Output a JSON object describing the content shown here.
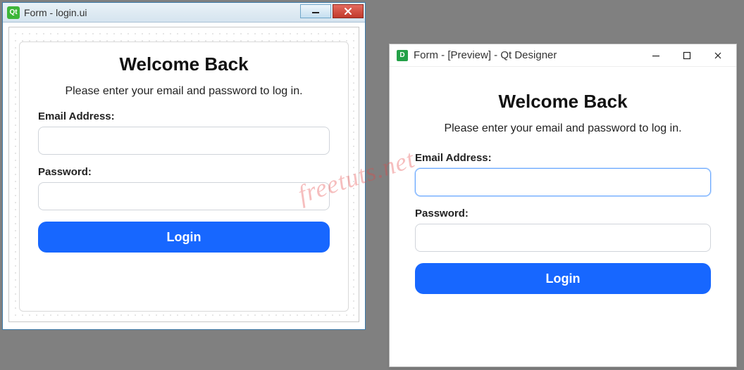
{
  "designer": {
    "window_title": "Form - login.ui",
    "icon_text": "Qt",
    "heading": "Welcome Back",
    "subtitle": "Please enter your email and password to log in.",
    "email_label": "Email Address:",
    "password_label": "Password:",
    "login_button": "Login"
  },
  "preview": {
    "window_title": "Form - [Preview] - Qt Designer",
    "icon_text": "D",
    "heading": "Welcome Back",
    "subtitle": "Please enter your email and password to log in.",
    "email_label": "Email Address:",
    "password_label": "Password:",
    "login_button": "Login"
  },
  "watermark": "freetuts.net"
}
